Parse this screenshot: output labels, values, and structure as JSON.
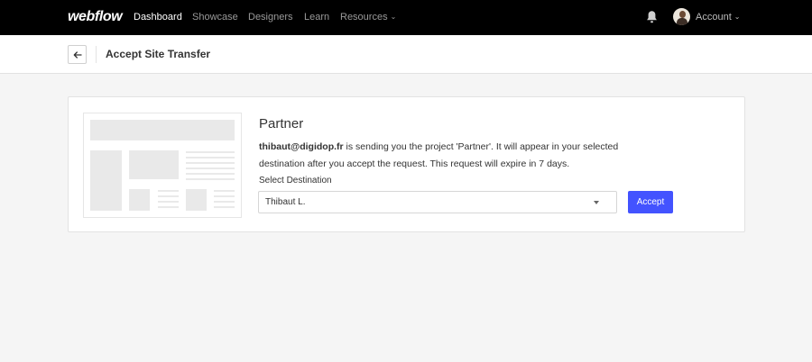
{
  "nav": {
    "logo": "webflow",
    "items": [
      {
        "label": "Dashboard",
        "active": true
      },
      {
        "label": "Showcase",
        "active": false
      },
      {
        "label": "Designers",
        "active": false
      },
      {
        "label": "Learn",
        "active": false
      },
      {
        "label": "Resources",
        "active": false,
        "dropdown": true
      }
    ],
    "account_label": "Account",
    "icons": {
      "notifications": "bell-icon",
      "account_caret": "chevron-down-icon"
    }
  },
  "header": {
    "back_icon": "arrow-left-icon",
    "title": "Accept Site Transfer"
  },
  "transfer": {
    "project_name": "Partner",
    "sender_email": "thibaut@digidop.fr",
    "message": " is sending you the project 'Partner'. It will appear in your selected destination after you accept the request. This request will expire in 7 days.",
    "select_label": "Select Destination",
    "select_value": "Thibaut L.",
    "accept_label": "Accept"
  },
  "colors": {
    "nav_bg": "#000000",
    "accent": "#4353ff",
    "page_bg": "#f5f5f5"
  }
}
